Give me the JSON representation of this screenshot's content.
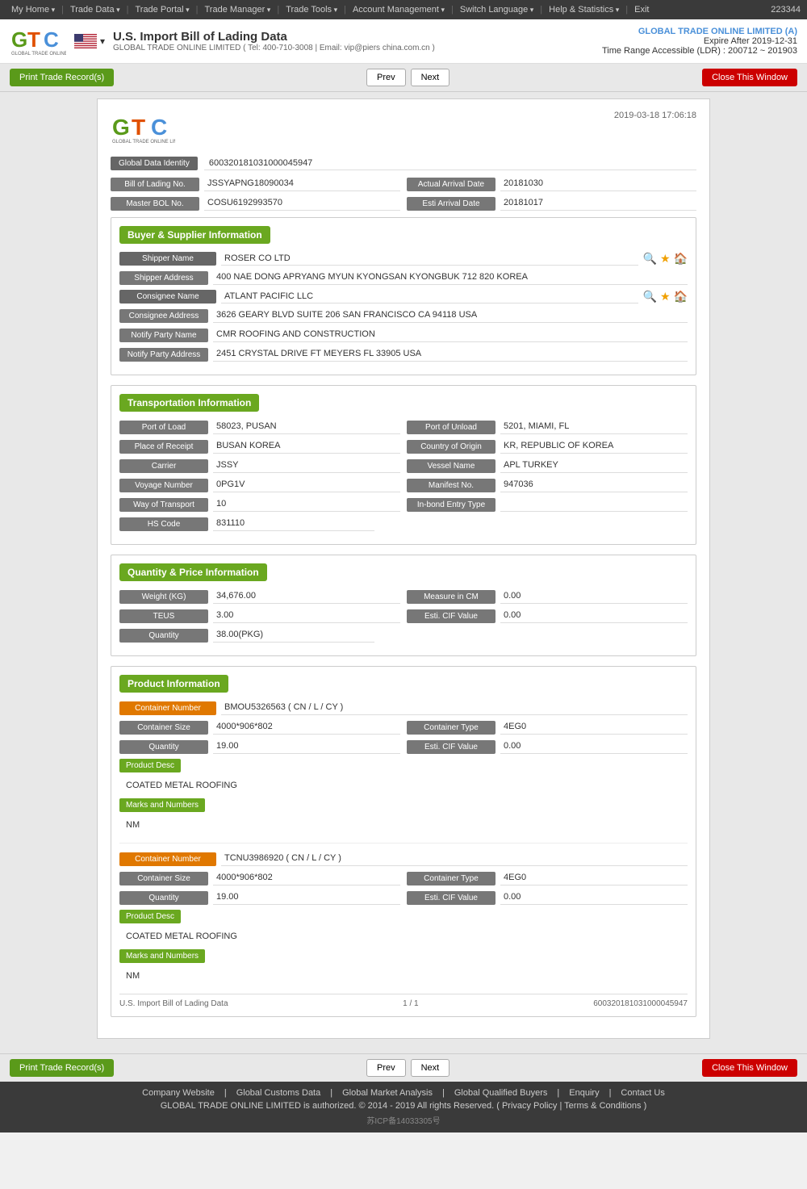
{
  "topNav": {
    "items": [
      "My Home",
      "Trade Data",
      "Trade Portal",
      "Trade Manager",
      "Trade Tools",
      "Account Management",
      "Switch Language",
      "Help & Statistics",
      "Exit"
    ],
    "userCode": "223344"
  },
  "header": {
    "title": "U.S. Import Bill of Lading Data",
    "subtitle": "GLOBAL TRADE ONLINE LIMITED ( Tel: 400-710-3008 | Email: vip@piers china.com.cn )",
    "company": "GLOBAL TRADE ONLINE LIMITED (A)",
    "expire": "Expire After 2019-12-31",
    "timeRange": "Time Range Accessible (LDR) : 200712 ~ 201903",
    "flagAlt": "US Flag"
  },
  "buttons": {
    "printRecord": "Print Trade Record(s)",
    "prev": "Prev",
    "next": "Next",
    "closeWindow": "Close This Window"
  },
  "document": {
    "logoText": "GTC",
    "logoSub": "GLOBAL TRADE ONLINE LIMITED",
    "datetime": "2019-03-18 17:06:18",
    "globalDataIdentityLabel": "Global Data Identity",
    "globalDataIdentityValue": "600320181031000045947",
    "bolNoLabel": "Bill of Lading No.",
    "bolNoValue": "JSSYAPNG18090034",
    "masterBolLabel": "Master BOL No.",
    "masterBolValue": "COSU6192993570",
    "actualArrivalLabel": "Actual Arrival Date",
    "actualArrivalValue": "20181030",
    "estiArrivalLabel": "Esti Arrival Date",
    "estiArrivalValue": "20181017"
  },
  "buyerSupplier": {
    "sectionTitle": "Buyer & Supplier Information",
    "shipperNameLabel": "Shipper Name",
    "shipperNameValue": "ROSER CO LTD",
    "shipperAddressLabel": "Shipper Address",
    "shipperAddressValue": "400 NAE DONG APRYANG MYUN KYONGSAN KYONGBUK 712 820 KOREA",
    "consigneeNameLabel": "Consignee Name",
    "consigneeNameValue": "ATLANT PACIFIC LLC",
    "consigneeAddressLabel": "Consignee Address",
    "consigneeAddressValue": "3626 GEARY BLVD SUITE 206 SAN FRANCISCO CA 94118 USA",
    "notifyPartyNameLabel": "Notify Party Name",
    "notifyPartyNameValue": "CMR ROOFING AND CONSTRUCTION",
    "notifyPartyAddressLabel": "Notify Party Address",
    "notifyPartyAddressValue": "2451 CRYSTAL DRIVE FT MEYERS FL 33905 USA"
  },
  "transportation": {
    "sectionTitle": "Transportation Information",
    "portOfLoadLabel": "Port of Load",
    "portOfLoadValue": "58023, PUSAN",
    "portOfUnloadLabel": "Port of Unload",
    "portOfUnloadValue": "5201, MIAMI, FL",
    "placeOfReceiptLabel": "Place of Receipt",
    "placeOfReceiptValue": "BUSAN KOREA",
    "countryOfOriginLabel": "Country of Origin",
    "countryOfOriginValue": "KR, REPUBLIC OF KOREA",
    "carrierLabel": "Carrier",
    "carrierValue": "JSSY",
    "vesselNameLabel": "Vessel Name",
    "vesselNameValue": "APL TURKEY",
    "voyageNumberLabel": "Voyage Number",
    "voyageNumberValue": "0PG1V",
    "manifestNoLabel": "Manifest No.",
    "manifestNoValue": "947036",
    "wayOfTransportLabel": "Way of Transport",
    "wayOfTransportValue": "10",
    "inbondEntryTypeLabel": "In-bond Entry Type",
    "inbondEntryTypeValue": "",
    "hsCodeLabel": "HS Code",
    "hsCodeValue": "831110"
  },
  "quantityPrice": {
    "sectionTitle": "Quantity & Price Information",
    "weightLabel": "Weight (KG)",
    "weightValue": "34,676.00",
    "measureInCMLabel": "Measure in CM",
    "measureInCMValue": "0.00",
    "teusLabel": "TEUS",
    "teusValue": "3.00",
    "estiCifValueLabel": "Esti. CIF Value",
    "estiCifValueValue": "0.00",
    "quantityLabel": "Quantity",
    "quantityValue": "38.00(PKG)"
  },
  "productInfo": {
    "sectionTitle": "Product Information",
    "containers": [
      {
        "containerNumberLabel": "Container Number",
        "containerNumberValue": "BMOU5326563 ( CN / L / CY )",
        "containerSizeLabel": "Container Size",
        "containerSizeValue": "4000*906*802",
        "containerTypeLabel": "Container Type",
        "containerTypeValue": "4EG0",
        "quantityLabel": "Quantity",
        "quantityValue": "19.00",
        "estiCifLabel": "Esti. CIF Value",
        "estiCifValue": "0.00",
        "productDescLabel": "Product Desc",
        "productDescValue": "COATED METAL ROOFING",
        "marksLabel": "Marks and Numbers",
        "marksValue": "NM"
      },
      {
        "containerNumberLabel": "Container Number",
        "containerNumberValue": "TCNU3986920 ( CN / L / CY )",
        "containerSizeLabel": "Container Size",
        "containerSizeValue": "4000*906*802",
        "containerTypeLabel": "Container Type",
        "containerTypeValue": "4EG0",
        "quantityLabel": "Quantity",
        "quantityValue": "19.00",
        "estiCifLabel": "Esti. CIF Value",
        "estiCifValue": "0.00",
        "productDescLabel": "Product Desc",
        "productDescValue": "COATED METAL ROOFING",
        "marksLabel": "Marks and Numbers",
        "marksValue": "NM"
      }
    ]
  },
  "docFooter": {
    "left": "U.S. Import Bill of Lading Data",
    "center": "1 / 1",
    "right": "600320181031000045947"
  },
  "pageFooter": {
    "links": [
      "Company Website",
      "Global Customs Data",
      "Global Market Analysis",
      "Global Qualified Buyers",
      "Enquiry",
      "Contact Us"
    ],
    "copyright": "GLOBAL TRADE ONLINE LIMITED is authorized. © 2014 - 2019 All rights Reserved.  (  Privacy Policy  |  Terms & Conditions  )",
    "beian": "苏ICP备14033305号"
  }
}
